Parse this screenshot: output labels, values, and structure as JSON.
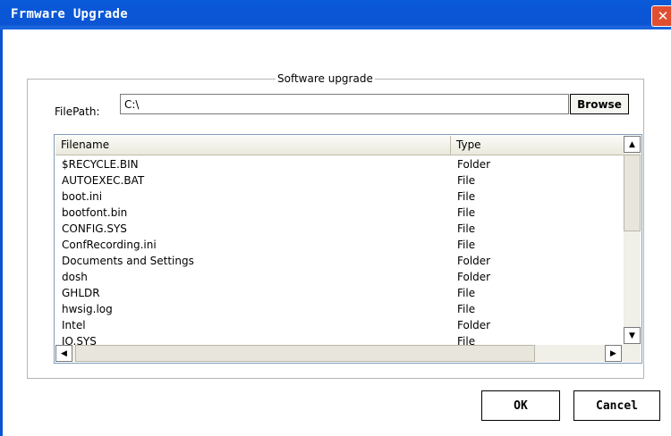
{
  "window": {
    "title": "Frmware Upgrade"
  },
  "group": {
    "title": "Software upgrade"
  },
  "filepath": {
    "label": "FilePath:",
    "value": "C:\\"
  },
  "buttons": {
    "browse": "Browse",
    "ok": "OK",
    "cancel": "Cancel"
  },
  "table": {
    "columns": [
      "Filename",
      "Type"
    ],
    "rows": [
      {
        "name": "$RECYCLE.BIN",
        "type": "Folder"
      },
      {
        "name": "AUTOEXEC.BAT",
        "type": "File"
      },
      {
        "name": "boot.ini",
        "type": "File"
      },
      {
        "name": "bootfont.bin",
        "type": "File"
      },
      {
        "name": "CONFIG.SYS",
        "type": "File"
      },
      {
        "name": "ConfRecording.ini",
        "type": "File"
      },
      {
        "name": "Documents and Settings",
        "type": "Folder"
      },
      {
        "name": "dosh",
        "type": "Folder"
      },
      {
        "name": "GHLDR",
        "type": "File"
      },
      {
        "name": "hwsig.log",
        "type": "File"
      },
      {
        "name": "Intel",
        "type": "Folder"
      },
      {
        "name": "IO.SYS",
        "type": "File"
      }
    ]
  }
}
